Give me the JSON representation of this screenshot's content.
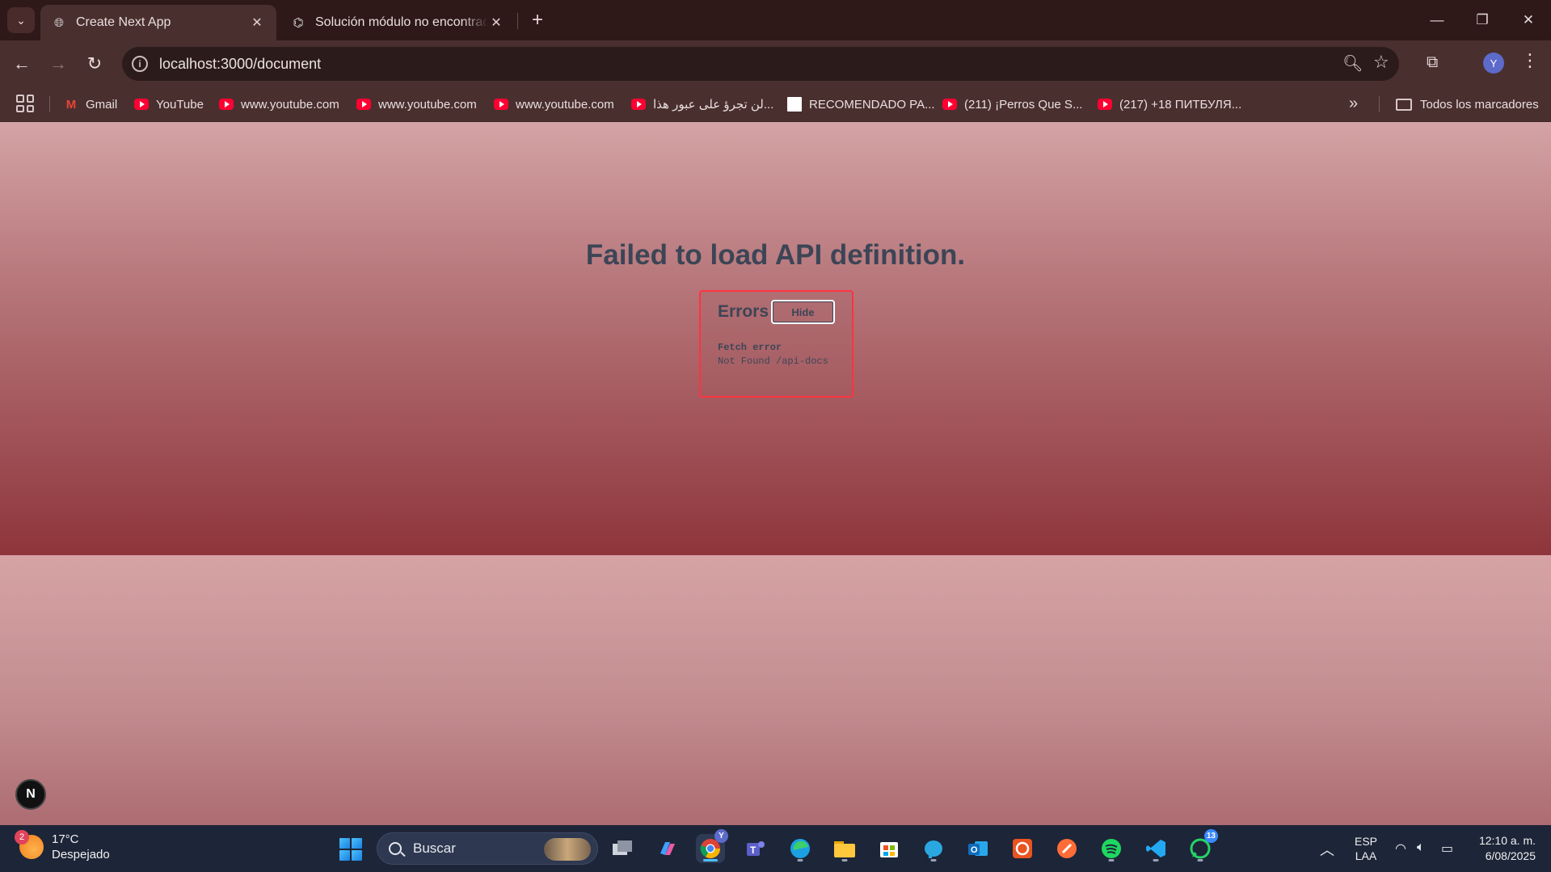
{
  "browser": {
    "tabs": [
      {
        "title": "Create Next App",
        "active": true
      },
      {
        "title": "Solución módulo no encontrado",
        "active": false
      }
    ],
    "url": "localhost:3000/document",
    "profile_initial": "Y",
    "bookmarks": [
      {
        "label": "Gmail",
        "icon": "gmail-icon"
      },
      {
        "label": "YouTube",
        "icon": "youtube-icon"
      },
      {
        "label": "www.youtube.com",
        "icon": "youtube-icon"
      },
      {
        "label": "www.youtube.com",
        "icon": "youtube-icon"
      },
      {
        "label": "www.youtube.com",
        "icon": "youtube-icon"
      },
      {
        "label": "لن تجرؤ على عبور هذا...",
        "icon": "youtube-icon"
      },
      {
        "label": "RECOMENDADO PA...",
        "icon": "page-icon"
      },
      {
        "label": "(211) ¡Perros Que S...",
        "icon": "youtube-icon"
      },
      {
        "label": "(217) +18 ПИТБУЛЯ...",
        "icon": "youtube-icon"
      }
    ],
    "all_bookmarks_label": "Todos los marcadores"
  },
  "page": {
    "title": "Failed to load API definition.",
    "errors_header": "Errors",
    "hide_label": "Hide",
    "error_line1": "Fetch error",
    "error_line2": "Not Found /api-docs",
    "next_badge": "N"
  },
  "taskbar": {
    "weather_temp": "17°C",
    "weather_desc": "Despejado",
    "weather_badge": "2",
    "search_placeholder": "Buscar",
    "chrome_badge": "Y",
    "whatsapp_badge": "13",
    "lang_line1": "ESP",
    "lang_line2": "LAA",
    "time": "12:10 a. m.",
    "date": "6/08/2025"
  }
}
